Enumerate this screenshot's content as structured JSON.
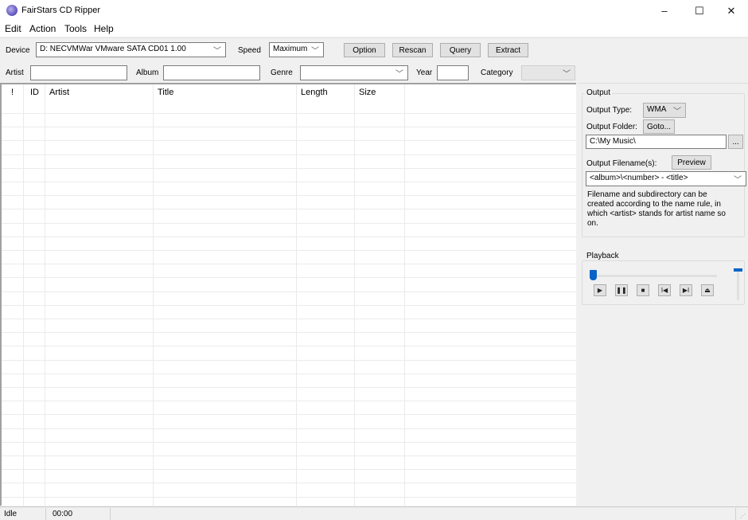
{
  "window": {
    "title": "FairStars CD Ripper",
    "controls": {
      "minimize": "–",
      "maximize": "☐",
      "close": "✕"
    }
  },
  "menu": [
    "Edit",
    "Action",
    "Tools",
    "Help"
  ],
  "toolbar": {
    "device_label": "Device",
    "device_value": "D: NECVMWar VMware SATA CD01 1.00",
    "speed_label": "Speed",
    "speed_value": "Maximum",
    "option_button": "Option",
    "rescan_button": "Rescan",
    "query_button": "Query",
    "extract_button": "Extract"
  },
  "filters": {
    "artist_label": "Artist",
    "artist_value": "",
    "album_label": "Album",
    "album_value": "",
    "genre_label": "Genre",
    "genre_value": "",
    "year_label": "Year",
    "year_value": "",
    "category_label": "Category",
    "category_value": ""
  },
  "track_list": {
    "columns": [
      "!",
      "ID",
      "Artist",
      "Title",
      "Length",
      "Size"
    ],
    "rows": []
  },
  "output": {
    "group_title": "Output",
    "type_label": "Output Type:",
    "type_value": "WMA",
    "folder_label": "Output Folder:",
    "goto_button": "Goto...",
    "folder_value": "C:\\My Music\\",
    "browse_button": "...",
    "filename_label": "Output Filename(s):",
    "preview_button": "Preview",
    "filename_value": "<album>\\<number> - <title>",
    "help_text": "Filename and subdirectory can be created according to the name rule, in which <artist> stands for artist name so on."
  },
  "playback": {
    "group_title": "Playback",
    "position_fraction": 0.0,
    "volume_fraction": 1.0,
    "buttons": {
      "play": "▶",
      "pause": "❚❚",
      "stop": "■",
      "prev": "I◀",
      "next": "▶I",
      "eject": "⏏"
    }
  },
  "status": {
    "state": "Idle",
    "time": "00:00"
  }
}
